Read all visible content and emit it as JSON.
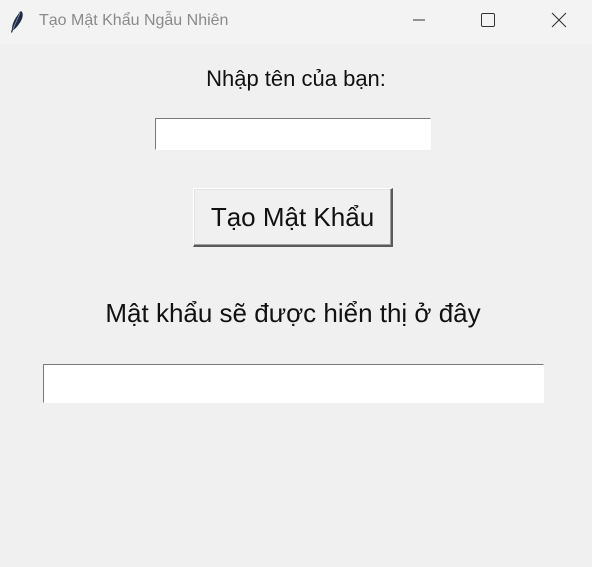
{
  "window": {
    "title": "Tạo Mật Khẩu Ngẫu Nhiên",
    "icon": "feather-icon",
    "controls": [
      "minimize-icon",
      "maximize-icon",
      "close-icon"
    ]
  },
  "form": {
    "name_label": "Nhập tên của bạn:",
    "name_value": "",
    "generate_button_label": "Tạo Mật Khẩu",
    "result_label": "Mật khẩu sẽ được hiển thị ở đây",
    "result_value": ""
  },
  "colors": {
    "background": "#f0f0f0",
    "titlebar": "#f3f3f3",
    "title_text": "#8a8a8a",
    "field_background": "#ffffff"
  }
}
